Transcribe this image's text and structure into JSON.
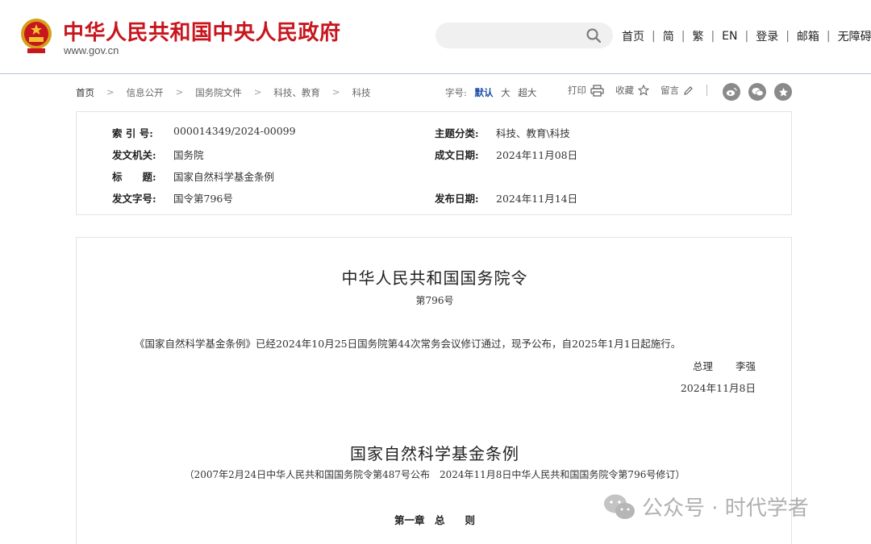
{
  "header": {
    "site_title": "中华人民共和国中央人民政府",
    "site_domain": "www.gov.cn",
    "search_placeholder": "",
    "nav": [
      "首页",
      "简",
      "繁",
      "EN",
      "登录",
      "邮箱",
      "无障碍"
    ],
    "brand_color": "#c8161e"
  },
  "breadcrumb": [
    "首页",
    "信息公开",
    "国务院文件",
    "科技、教育",
    "科技"
  ],
  "font_size": {
    "label": "字号:",
    "options": [
      "默认",
      "大",
      "超大"
    ],
    "active": "默认"
  },
  "tools": {
    "print": "打印",
    "favorite": "收藏",
    "comment": "留言"
  },
  "share": [
    "weibo-icon",
    "wechat-icon",
    "star-icon"
  ],
  "info": {
    "index_label": "索 引 号:",
    "index_value": "000014349/2024-00099",
    "category_label": "主题分类:",
    "category_value": "科技、教育\\科技",
    "issuer_label": "发文机关:",
    "issuer_value": "国务院",
    "written_label": "成文日期:",
    "written_value": "2024年11月08日",
    "title_label": "标　　题:",
    "title_value": "国家自然科学基金条例",
    "doc_no_label": "发文字号:",
    "doc_no_value": "国令第796号",
    "publish_label": "发布日期:",
    "publish_value": "2024年11月14日"
  },
  "document": {
    "order_title": "中华人民共和国国务院令",
    "order_number": "第796号",
    "paragraph": "《国家自然科学基金条例》已经2024年10月25日国务院第44次常务会议修订通过，现予公布，自2025年1月1日起施行。",
    "signer_role": "总理",
    "signer_name": "李强",
    "sign_date": "2024年11月8日",
    "reg_title": "国家自然科学基金条例",
    "reg_subtitle": "（2007年2月24日中华人民共和国国务院令第487号公布　2024年11月8日中华人民共和国国务院令第796号修订）",
    "chapter": "第一章　总　　则"
  },
  "watermark": "公众号 · 时代学者"
}
